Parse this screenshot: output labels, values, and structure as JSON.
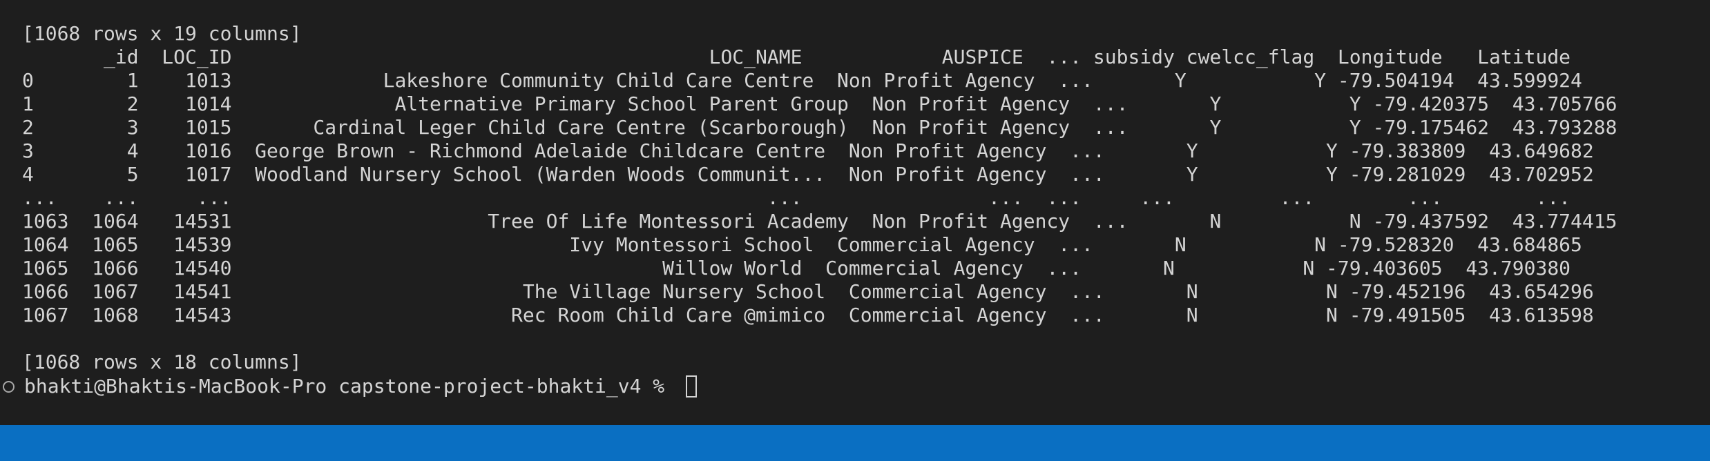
{
  "terminal": {
    "lines": [
      "[1068 rows x 19 columns]",
      "       _id  LOC_ID                                         LOC_NAME            AUSPICE  ... subsidy cwelcc_flag  Longitude   Latitude",
      "0        1    1013             Lakeshore Community Child Care Centre  Non Profit Agency  ...       Y           Y -79.504194  43.599924",
      "1        2    1014              Alternative Primary School Parent Group  Non Profit Agency  ...       Y           Y -79.420375  43.705766",
      "2        3    1015       Cardinal Leger Child Care Centre (Scarborough)  Non Profit Agency  ...       Y           Y -79.175462  43.793288",
      "3        4    1016  George Brown - Richmond Adelaide Childcare Centre  Non Profit Agency  ...       Y           Y -79.383809  43.649682",
      "4        5    1017  Woodland Nursery School (Warden Woods Communit...  Non Profit Agency  ...       Y           Y -79.281029  43.702952",
      "...    ...     ...                                              ...                ...  ...     ...         ...        ...        ...",
      "1063  1064   14531                      Tree Of Life Montessori Academy  Non Profit Agency  ...       N           N -79.437592  43.774415",
      "1064  1065   14539                             Ivy Montessori School  Commercial Agency  ...       N           N -79.528320  43.684865",
      "1065  1066   14540                                     Willow World  Commercial Agency  ...       N           N -79.403605  43.790380",
      "1066  1067   14541                         The Village Nursery School  Commercial Agency  ...       N           N -79.452196  43.654296",
      "1067  1068   14543                        Rec Room Child Care @mimico  Commercial Agency  ...       N           N -79.491505  43.613598",
      "",
      "[1068 rows x 18 columns]"
    ],
    "prompt": "bhakti@Bhaktis-MacBook-Pro capstone-project-bhakti_v4 % "
  },
  "colors": {
    "background": "#1e1e1e",
    "text": "#d4d4d4",
    "statusbar": "#0a6fc2"
  }
}
